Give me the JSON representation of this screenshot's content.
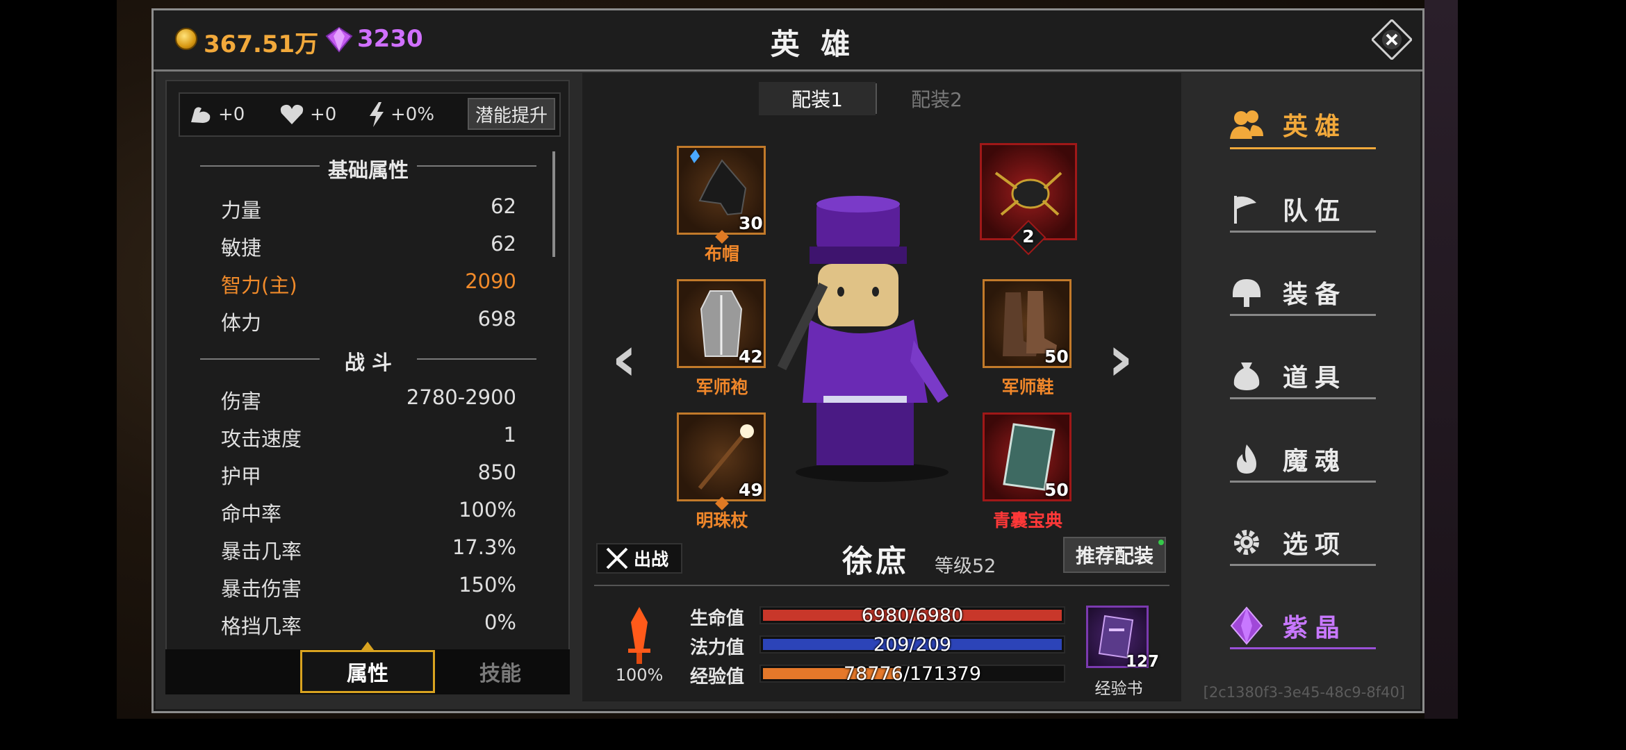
{
  "currency": {
    "gold": "367.51万",
    "gems": "3230"
  },
  "title": "英 雄",
  "potential": {
    "str_bonus": "+0",
    "hp_bonus": "+0",
    "speed_bonus": "+0%",
    "button_label": "潜能提升"
  },
  "stats": {
    "basic_title": "基础属性",
    "basic": [
      {
        "label": "力量",
        "value": "62"
      },
      {
        "label": "敏捷",
        "value": "62"
      },
      {
        "label": "智力(主)",
        "value": "2090"
      },
      {
        "label": "体力",
        "value": "698"
      }
    ],
    "combat_title": "战 斗",
    "combat": [
      {
        "label": "伤害",
        "value": "2780-2900"
      },
      {
        "label": "攻击速度",
        "value": "1"
      },
      {
        "label": "护甲",
        "value": "850"
      },
      {
        "label": "命中率",
        "value": "100%"
      },
      {
        "label": "暴击几率",
        "value": "17.3%"
      },
      {
        "label": "暴击伤害",
        "value": "150%"
      },
      {
        "label": "格挡几率",
        "value": "0%"
      }
    ]
  },
  "bottom_tabs": {
    "attributes": "属性",
    "skills": "技能"
  },
  "loadout_tabs": [
    "配装1",
    "配装2"
  ],
  "equipment": {
    "hat": {
      "name": "布帽",
      "level": "30"
    },
    "robe": {
      "name": "军师袍",
      "level": "42"
    },
    "staff": {
      "name": "明珠杖",
      "level": "49"
    },
    "pet": {
      "level": "2"
    },
    "shoes": {
      "name": "军师鞋",
      "level": "50"
    },
    "book": {
      "name": "青囊宝典",
      "level": "50"
    }
  },
  "hero": {
    "deploy_label": "出战",
    "name": "徐庶",
    "level": "等级52",
    "recommend_label": "推荐配装"
  },
  "bars": {
    "hp": {
      "label": "生命值",
      "text": "6980/6980",
      "current": 6980,
      "max": 6980,
      "color": "#c8372a"
    },
    "mp": {
      "label": "法力值",
      "text": "209/209",
      "current": 209,
      "max": 209,
      "color": "#2c44b8"
    },
    "exp": {
      "label": "经验值",
      "text": "78776/171379",
      "current": 78776,
      "max": 171379,
      "color": "#e5782a"
    }
  },
  "sword_percent": "100%",
  "exp_book": {
    "count": "127",
    "label": "经验书"
  },
  "nav": [
    {
      "label": "英雄",
      "icon": "heroes-icon",
      "active": true
    },
    {
      "label": "队伍",
      "icon": "flag-icon",
      "active": false
    },
    {
      "label": "装备",
      "icon": "helmet-icon",
      "active": false
    },
    {
      "label": "道具",
      "icon": "bag-icon",
      "active": false
    },
    {
      "label": "魔魂",
      "icon": "flame-icon",
      "active": false
    },
    {
      "label": "选项",
      "icon": "gear-icon",
      "active": false
    },
    {
      "label": "紫晶",
      "icon": "amethyst-icon",
      "active": false
    }
  ],
  "uuid": "[2c1380f3-3e45-48c9-8f40]",
  "colors": {
    "gold": "#f2a93b",
    "purple": "#d070ff",
    "highlight": "#f08a2a",
    "red_name": "#ff3838"
  }
}
